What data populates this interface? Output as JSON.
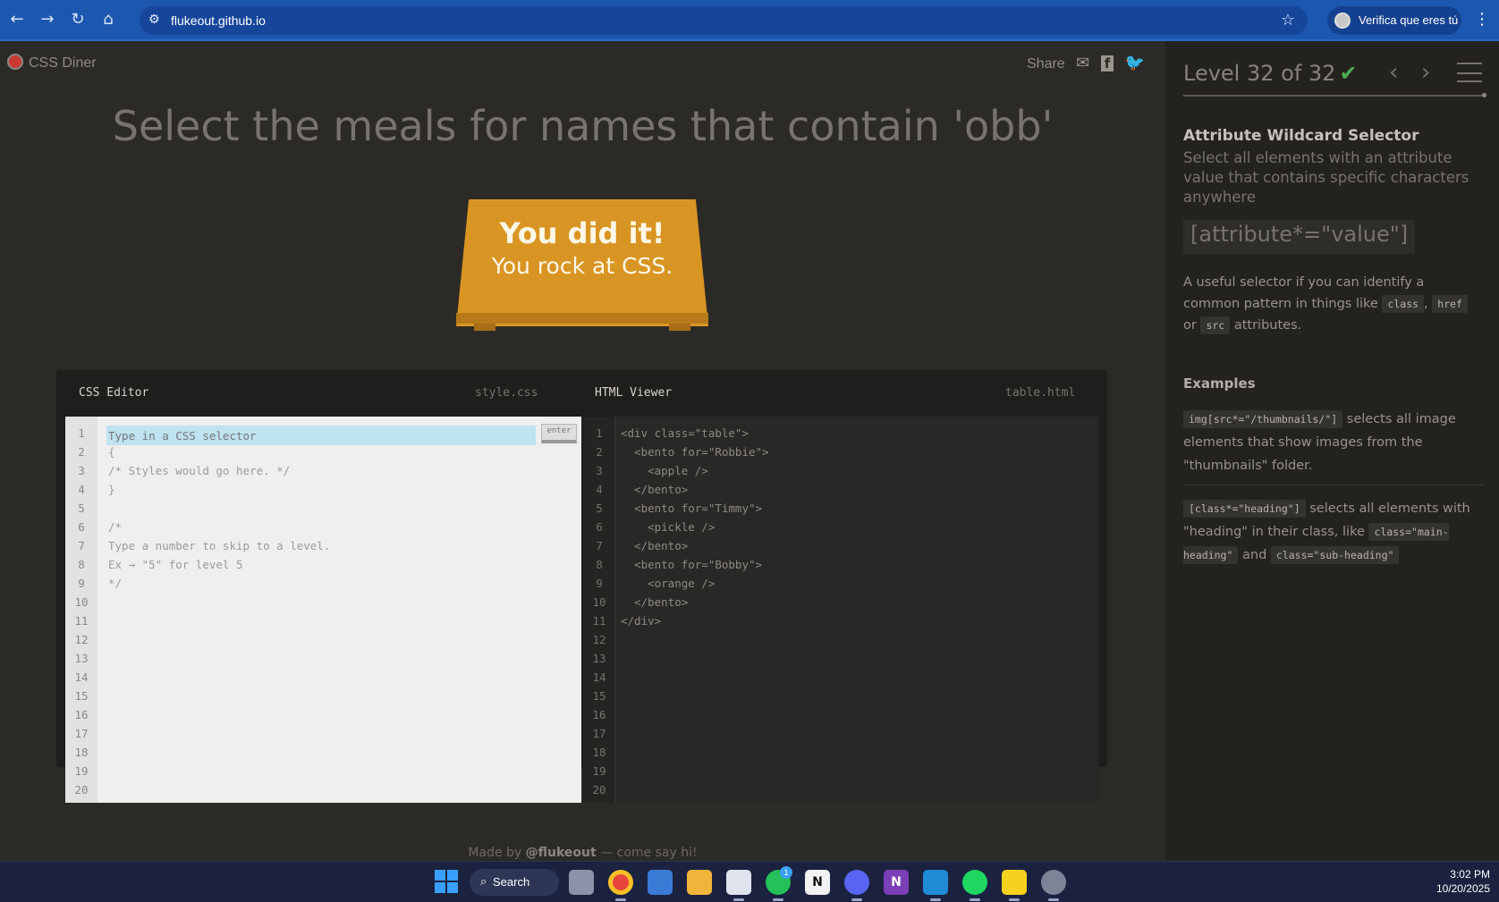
{
  "browser": {
    "url": "flukeout.github.io",
    "profile_label": "Verifica que eres tú",
    "back_icon": "←",
    "forward_icon": "→",
    "reload_icon": "↻",
    "home_icon": "⌂",
    "star_icon": "☆",
    "menu_icon": "⋮",
    "site_info_icon": "⚙"
  },
  "header": {
    "app_name": "CSS Diner",
    "share_label": "Share",
    "share_icons": [
      "✉",
      "f",
      "🐦"
    ]
  },
  "main": {
    "instruction": "Select the meals for names that contain 'obb'",
    "win_line1": "You did it!",
    "win_line2": "You rock at CSS.",
    "credit_prefix": "Made by",
    "credit_author": "@flukeout",
    "credit_suffix": "— come say hi!"
  },
  "css_editor": {
    "title": "CSS Editor",
    "filename": "style.css",
    "placeholder": "Type in a CSS selector",
    "enter_label": "enter",
    "lines": [
      "",
      "{",
      "/* Styles would go here. */",
      "}",
      "",
      "/*",
      "Type a number to skip to a level.",
      "Ex → \"5\" for level 5",
      "*/",
      "",
      "",
      "",
      "",
      "",
      "",
      "",
      "",
      "",
      "",
      ""
    ],
    "line_numbers": [
      "1",
      "2",
      "3",
      "4",
      "5",
      "6",
      "7",
      "8",
      "9",
      "10",
      "11",
      "12",
      "13",
      "14",
      "15",
      "16",
      "17",
      "18",
      "19",
      "20"
    ]
  },
  "html_viewer": {
    "title": "HTML Viewer",
    "filename": "table.html",
    "lines": [
      "<div class=\"table\">",
      "  <bento for=\"Robbie\">",
      "    <apple />",
      "  </bento>",
      "  <bento for=\"Timmy\">",
      "    <pickle />",
      "  </bento>",
      "  <bento for=\"Bobby\">",
      "    <orange />",
      "  </bento>",
      "</div>",
      "",
      "",
      "",
      "",
      "",
      "",
      "",
      "",
      ""
    ],
    "line_numbers": [
      "1",
      "2",
      "3",
      "4",
      "5",
      "6",
      "7",
      "8",
      "9",
      "10",
      "11",
      "12",
      "13",
      "14",
      "15",
      "16",
      "17",
      "18",
      "19",
      "20"
    ]
  },
  "sidebar": {
    "level_label": "Level 32 of 32",
    "check": "✔",
    "prev": "‹",
    "next": "›",
    "selector_name": "Attribute Wildcard Selector",
    "selector_desc": "Select all elements with an attribute value that contains specific characters anywhere",
    "syntax": "[attribute*=\"value\"]",
    "hint_a": "A useful selector if you can identify a common pattern in things like",
    "hint_code1": "class",
    "hint_sep1": ",",
    "hint_code2": "href",
    "hint_or": "or",
    "hint_code3": "src",
    "hint_b": "attributes.",
    "examples_heading": "Examples",
    "ex1_code": "img[src*=\"/thumbnails/\"]",
    "ex1_text": "selects all image elements that show images from the \"thumbnails\" folder.",
    "ex2_code": "[class*=\"heading\"]",
    "ex2_text": "selects all elements with \"heading\" in their class, like",
    "ex2_code2": "class=\"main-heading\"",
    "ex2_and": "and",
    "ex2_code3": "class=\"sub-heading\""
  },
  "taskbar": {
    "search_label": "Search",
    "time": "3:02 PM",
    "date": "10/20/2025",
    "whatsapp_badge": "1"
  }
}
